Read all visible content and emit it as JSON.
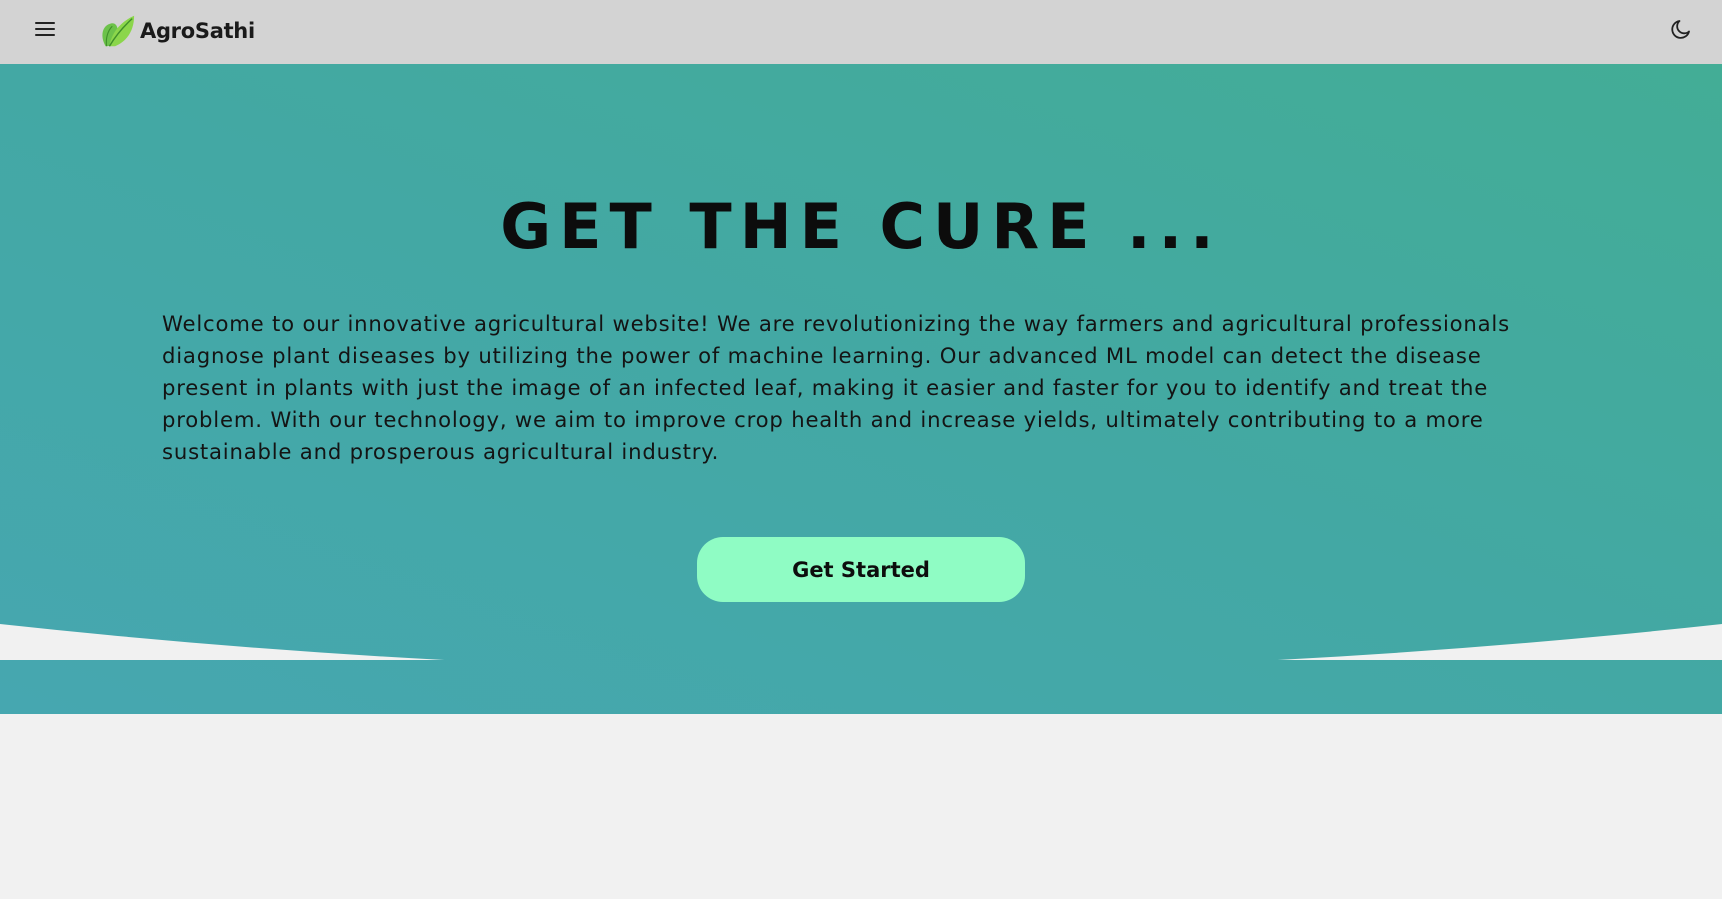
{
  "navbar": {
    "brand_name": "AgroSathi",
    "menu_icon": "hamburger-menu-icon",
    "logo_icon": "leaf-icon",
    "theme_icon": "moon-icon"
  },
  "hero": {
    "title": "GET THE CURE ...",
    "description": "Welcome to our innovative agricultural website! We are revolutionizing the way farmers and agricultural professionals diagnose plant diseases by utilizing the power of machine learning. Our advanced ML model can detect the disease present in plants with just the image of an infected leaf, making it easier and faster for you to identify and treat the problem. With our technology, we aim to improve crop health and increase yields, ultimately contributing to a more sustainable and prosperous agricultural industry.",
    "cta_label": "Get Started"
  },
  "colors": {
    "navbar_bg": "#d3d3d3",
    "hero_gradient_start": "#43ad96",
    "hero_gradient_end": "#46a7b0",
    "cta_bg": "#8ffcc4",
    "page_bg": "#f1f1f1"
  }
}
